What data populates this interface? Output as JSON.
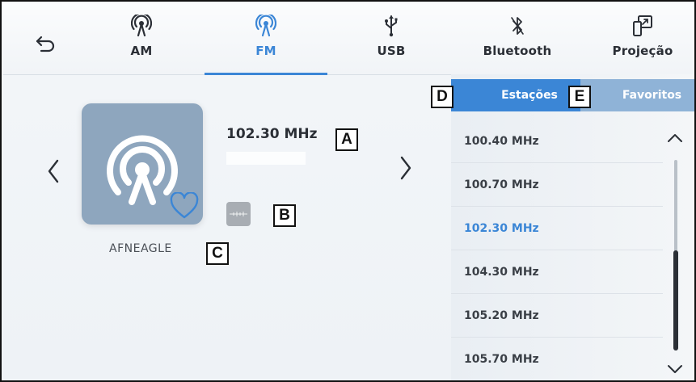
{
  "tabs": [
    {
      "label": "AM",
      "icon": "radio-antenna-icon"
    },
    {
      "label": "FM",
      "icon": "radio-antenna-icon",
      "active": true
    },
    {
      "label": "USB",
      "icon": "usb-icon"
    },
    {
      "label": "Bluetooth",
      "icon": "bluetooth-icon"
    },
    {
      "label": "Projeção",
      "icon": "phone-projection-icon"
    }
  ],
  "player": {
    "frequency": "102.30 MHz",
    "station_name": "AFNEAGLE"
  },
  "list_tabs": {
    "stations_label": "Estações",
    "favorites_label": "Favoritos"
  },
  "stations": [
    "100.40 MHz",
    "100.70 MHz",
    "102.30 MHz",
    "104.30 MHz",
    "105.20 MHz",
    "105.70 MHz"
  ],
  "selected_station": "102.30 MHz",
  "callouts": {
    "a": "A",
    "b": "B",
    "c": "C",
    "d": "D",
    "e": "E"
  },
  "colors": {
    "accent": "#3b86d6",
    "art_bg": "#8ea6be",
    "favorites_tab": "#8fb3d7"
  }
}
